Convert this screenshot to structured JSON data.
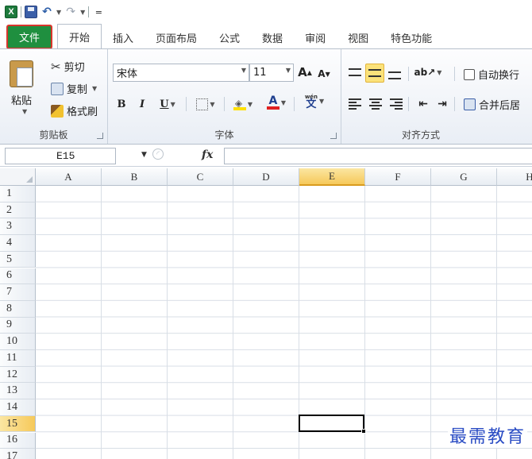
{
  "qat": {
    "icons": [
      "excel-logo",
      "save-icon",
      "undo-icon",
      "redo-icon",
      "customize-caret"
    ],
    "excel_letter": "X",
    "customize_symbol": "="
  },
  "tabs": [
    {
      "label": "文件",
      "highlighted": true
    },
    {
      "label": "开始",
      "active": true
    },
    {
      "label": "插入"
    },
    {
      "label": "页面布局"
    },
    {
      "label": "公式"
    },
    {
      "label": "数据"
    },
    {
      "label": "审阅"
    },
    {
      "label": "视图"
    },
    {
      "label": "特色功能"
    }
  ],
  "ribbon": {
    "clipboard": {
      "label": "剪贴板",
      "paste": "粘贴",
      "cut": "剪切",
      "copy": "复制",
      "format_painter": "格式刷"
    },
    "font": {
      "label": "字体",
      "font_name": "宋体",
      "font_size": "11",
      "grow_font": "A",
      "shrink_font": "A",
      "bold": "B",
      "italic": "I",
      "underline": "U",
      "font_color_letter": "A",
      "phonetic": "wén",
      "phonetic_char": "文"
    },
    "alignment": {
      "label": "对齐方式",
      "wrap_text": "自动换行",
      "merge_center": "合并后居"
    }
  },
  "formula_bar": {
    "name_box": "E15",
    "fx": "fx",
    "value": ""
  },
  "grid": {
    "columns": [
      "A",
      "B",
      "C",
      "D",
      "E",
      "F",
      "G",
      "H"
    ],
    "rows": [
      "1",
      "2",
      "3",
      "4",
      "5",
      "6",
      "7",
      "8",
      "9",
      "10",
      "11",
      "12",
      "13",
      "14",
      "15",
      "16",
      "17"
    ],
    "selected_column": "E",
    "selected_row": "15"
  },
  "watermark": "最需教育",
  "colors": {
    "file_tab": "#1f8f3f",
    "highlight_box": "#d9362d",
    "selected_header": "#f6c95a",
    "watermark": "#2a4cc4"
  }
}
